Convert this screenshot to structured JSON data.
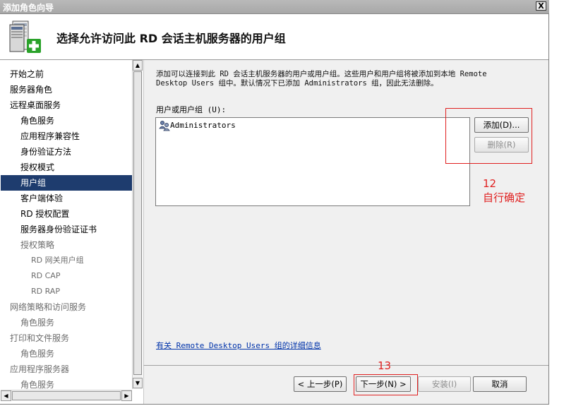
{
  "window": {
    "title": "添加角色向导",
    "close_glyph": "X"
  },
  "header": {
    "title": "选择允许访问此 RD 会话主机服务器的用户组",
    "icon": "server-add-icon"
  },
  "sidebar": {
    "items": [
      {
        "label": "开始之前",
        "level": 0,
        "state": "normal"
      },
      {
        "label": "服务器角色",
        "level": 0,
        "state": "normal"
      },
      {
        "label": "远程桌面服务",
        "level": 0,
        "state": "normal"
      },
      {
        "label": "角色服务",
        "level": 1,
        "state": "normal"
      },
      {
        "label": "应用程序兼容性",
        "level": 1,
        "state": "normal"
      },
      {
        "label": "身份验证方法",
        "level": 1,
        "state": "normal"
      },
      {
        "label": "授权模式",
        "level": 1,
        "state": "normal"
      },
      {
        "label": "用户组",
        "level": 1,
        "state": "active"
      },
      {
        "label": "客户端体验",
        "level": 1,
        "state": "normal"
      },
      {
        "label": "RD 授权配置",
        "level": 1,
        "state": "normal"
      },
      {
        "label": "服务器身份验证证书",
        "level": 1,
        "state": "normal"
      },
      {
        "label": "授权策略",
        "level": 1,
        "state": "dim"
      },
      {
        "label": "RD 网关用户组",
        "level": 2,
        "state": "dim"
      },
      {
        "label": "RD CAP",
        "level": 2,
        "state": "dim"
      },
      {
        "label": "RD RAP",
        "level": 2,
        "state": "dim"
      },
      {
        "label": "网络策略和访问服务",
        "level": 0,
        "state": "dim"
      },
      {
        "label": "角色服务",
        "level": 1,
        "state": "dim"
      },
      {
        "label": "打印和文件服务",
        "level": 0,
        "state": "dim"
      },
      {
        "label": "角色服务",
        "level": 1,
        "state": "dim"
      },
      {
        "label": "应用程序服务器",
        "level": 0,
        "state": "dim"
      },
      {
        "label": "角色服务",
        "level": 1,
        "state": "dim"
      }
    ]
  },
  "main": {
    "description_line1": "添加可以连接到此 RD 会话主机服务器的用户或用户组。这些用户和用户组将被添加到本地 Remote",
    "description_line2": "Desktop Users 组中。默认情况下已添加 Administrators 组，因此无法删除。",
    "field_label": "用户或用户组 (U):",
    "list_items": [
      "Administrators"
    ],
    "add_button": "添加(D)...",
    "remove_button": "删除(R)",
    "info_link": "有关 Remote Desktop Users 组的详细信息"
  },
  "annotations": {
    "step12_number": "12",
    "step12_text": "自行确定",
    "step13_number": "13",
    "color": "#e02020"
  },
  "footer": {
    "prev_button": "< 上一步(P)",
    "next_button": "下一步(N) >",
    "install_button": "安装(I)",
    "cancel_button": "取消"
  }
}
